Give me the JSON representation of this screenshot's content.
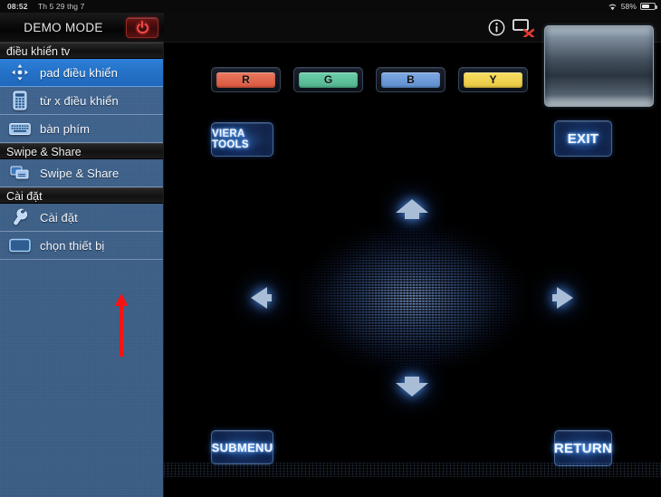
{
  "status_bar": {
    "time": "08:52",
    "date": "Th 5 29 thg 7",
    "battery_percent": "58%",
    "wifi_icon": "wifi-icon",
    "battery_icon": "battery-icon"
  },
  "header": {
    "title": "DEMO MODE",
    "power_icon": "power-icon"
  },
  "sidebar": {
    "sections": [
      {
        "title": "điều khiển tv",
        "items": [
          {
            "label": "pad điều khiển",
            "icon": "dpad-icon",
            "selected": true
          },
          {
            "label": "từ x điều khiển",
            "icon": "remote-keypad-icon",
            "selected": false
          },
          {
            "label": "bàn phím",
            "icon": "keyboard-icon",
            "selected": false
          }
        ]
      },
      {
        "title": "Swipe & Share",
        "items": [
          {
            "label": "Swipe & Share",
            "icon": "swipe-share-icon",
            "selected": false
          }
        ]
      },
      {
        "title": "Cài đặt",
        "items": [
          {
            "label": "Cài đặt",
            "icon": "wrench-icon",
            "selected": false
          },
          {
            "label": "chọn thiết bị",
            "icon": "tv-icon",
            "selected": false
          }
        ]
      }
    ],
    "annotation": {
      "type": "red-arrow-up",
      "color": "#f41414"
    }
  },
  "main": {
    "topbar_icons": [
      {
        "name": "info-icon",
        "glyph": "i"
      },
      {
        "name": "cast-disconnected-icon",
        "glyph": "tv-x"
      }
    ],
    "preview_screen": {
      "name": "tv-preview-screen"
    },
    "color_buttons": [
      {
        "label": "R",
        "color": "#e0654c"
      },
      {
        "label": "G",
        "color": "#5cc09b"
      },
      {
        "label": "B",
        "color": "#6b9ad8"
      },
      {
        "label": "Y",
        "color": "#f0d24e"
      }
    ],
    "buttons": {
      "viera_tools": "VIERA TOOLS",
      "exit": "EXIT",
      "submenu": "SUBMENU",
      "return": "RETURN"
    },
    "dpad": {
      "up": "up-arrow",
      "down": "down-arrow",
      "left": "left-arrow",
      "right": "right-arrow"
    }
  }
}
